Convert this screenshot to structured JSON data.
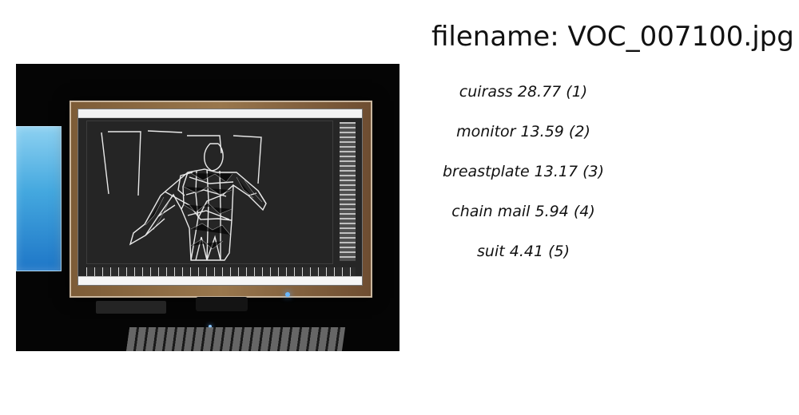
{
  "header": {
    "filename_text": "filename: VOC_007100.jpg"
  },
  "predictions": [
    "cuirass 28.77 (1)",
    "monitor 13.59 (2)",
    "breastplate 13.17 (3)",
    "chain mail  5.94 (4)",
    "suit  4.41 (5)"
  ],
  "colors": {
    "background": "#ffffff",
    "text": "#111111",
    "photo_background": "#050505",
    "monitor_frame": "#8a6a43",
    "screen_background": "#262626",
    "wireframe": "#f4f4f4",
    "left_screen_blue": "#44a8df",
    "indicator_blue": "#6ab8ff"
  }
}
